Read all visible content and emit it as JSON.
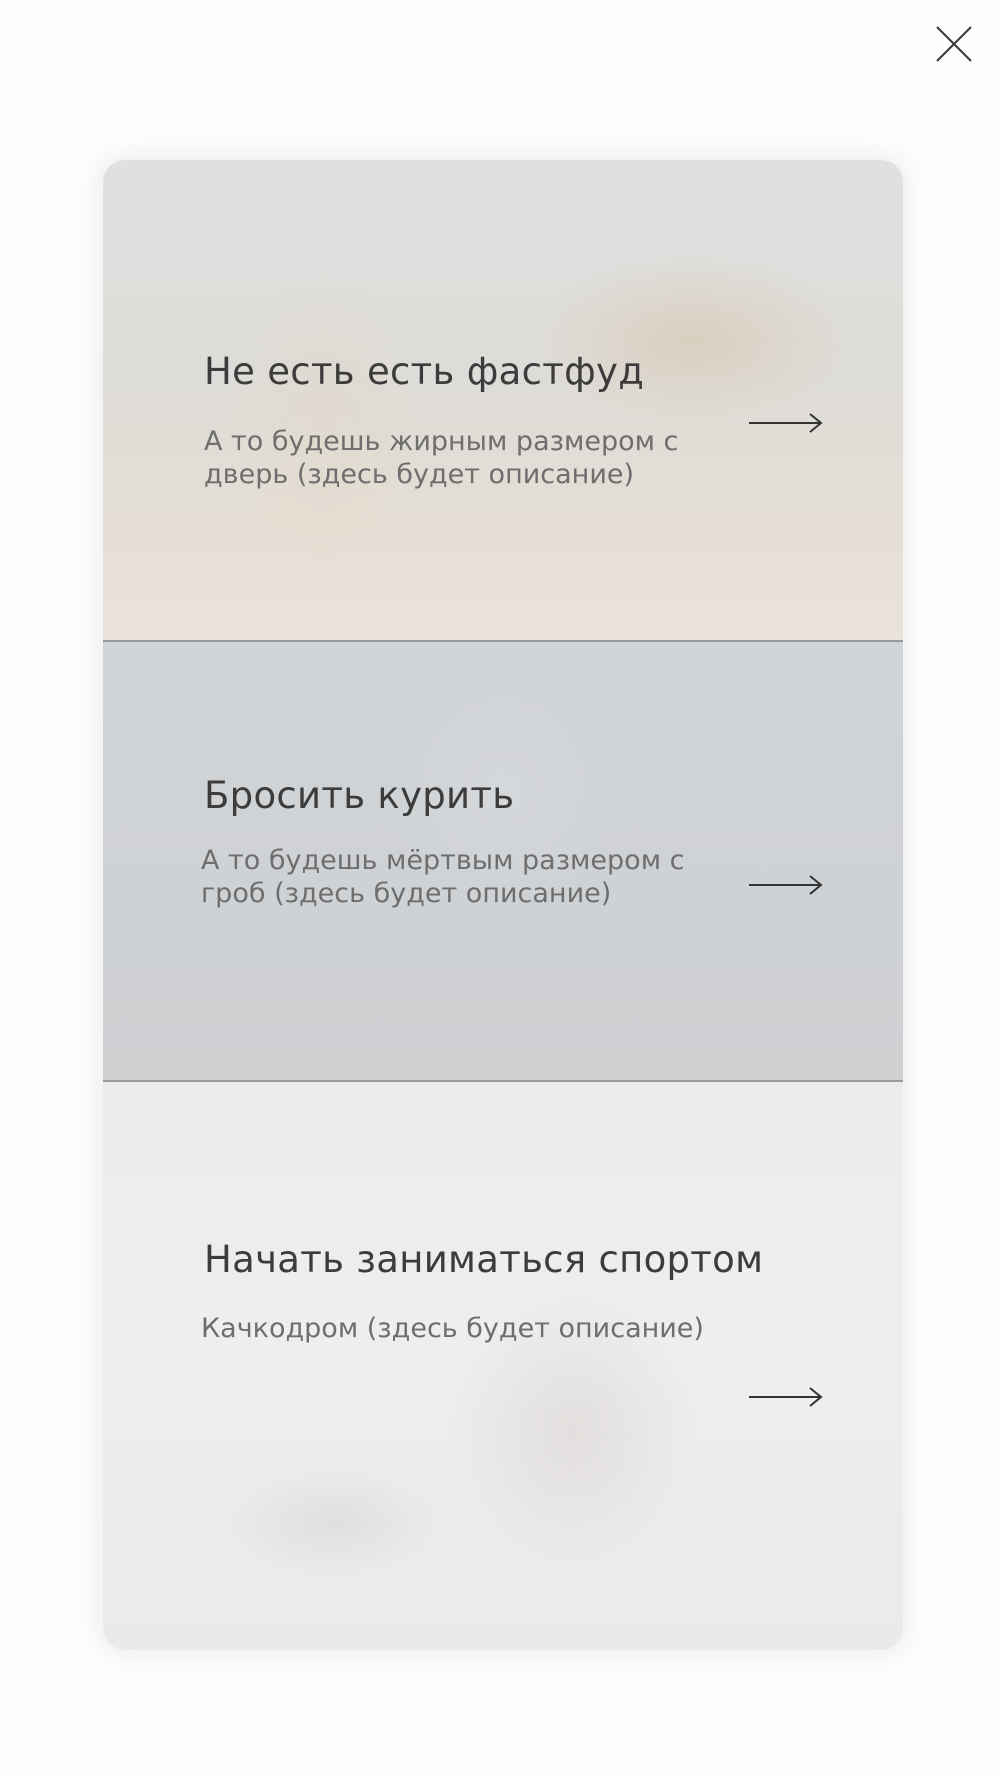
{
  "close": {
    "icon": "close-icon"
  },
  "goals": [
    {
      "title": "Не есть есть фастфуд",
      "description": "А то будешь жирным размером с дверь (здесь будет описание)",
      "icon": "arrow-right-icon"
    },
    {
      "title": "Бросить курить",
      "description": "А то будешь мёртвым размером с гроб (здесь будет описание)",
      "icon": "arrow-right-icon"
    },
    {
      "title": "Начать заниматься спортом",
      "description": "Качкодром (здесь будет описание)",
      "icon": "arrow-right-icon"
    }
  ],
  "colors": {
    "text": "#3c3c3c",
    "description": "#6e6e6e",
    "divider": "#9a9a9a",
    "background": "#fdfdfd"
  }
}
